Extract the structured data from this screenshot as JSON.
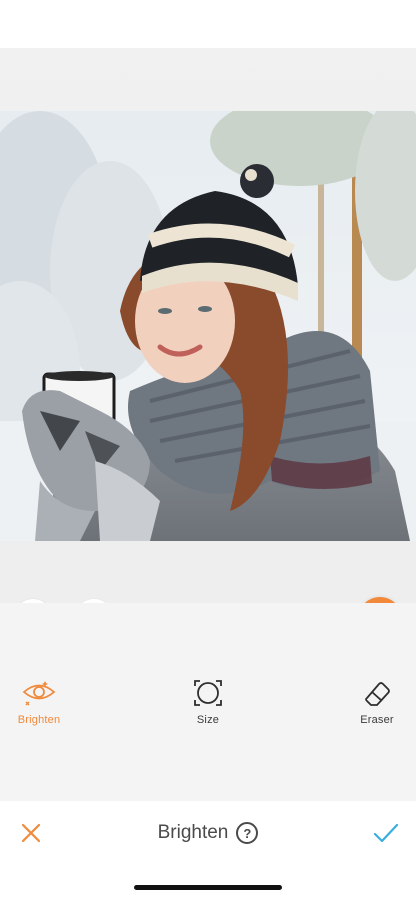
{
  "tools": [
    {
      "label": "Brighten",
      "icon": "eye-sparkle-icon",
      "active": true
    },
    {
      "label": "Size",
      "icon": "size-circle-icon",
      "active": false
    },
    {
      "label": "Eraser",
      "icon": "eraser-icon",
      "active": false
    }
  ],
  "bottom_bar": {
    "title": "Brighten",
    "help_label": "?",
    "cancel_icon": "close-icon",
    "confirm_icon": "checkmark-icon"
  },
  "colors": {
    "accent": "#f2883a",
    "confirm": "#3aaee0",
    "text": "#3b3b3b"
  }
}
